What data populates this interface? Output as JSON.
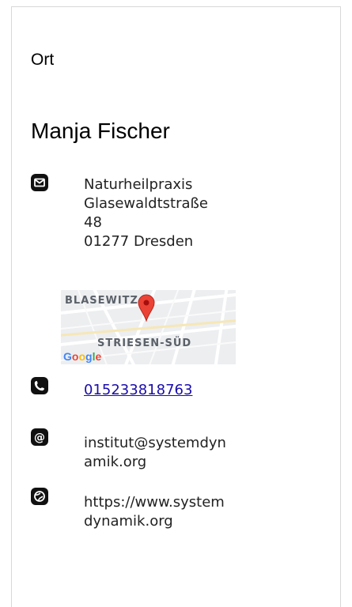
{
  "section": {
    "title": "Ort"
  },
  "contact": {
    "name": "Manja Fischer",
    "address": {
      "icon": "mail-icon",
      "lines": [
        "Naturheilpraxis",
        "Glasewaldtstraße",
        "48",
        "01277 Dresden"
      ]
    },
    "map": {
      "labels": [
        "BLASEWITZ",
        "STRIESEN-SÜD"
      ],
      "provider": "Google",
      "marker": "map-pin-icon",
      "marker_color": "#ea4335"
    },
    "phone": {
      "icon": "phone-icon",
      "value": "015233818763"
    },
    "email": {
      "icon": "at-icon",
      "lines": [
        "institut@systemdyn",
        "amik.org"
      ]
    },
    "website": {
      "icon": "globe-icon",
      "lines": [
        "https://www.system",
        "dynamik.org"
      ]
    }
  }
}
